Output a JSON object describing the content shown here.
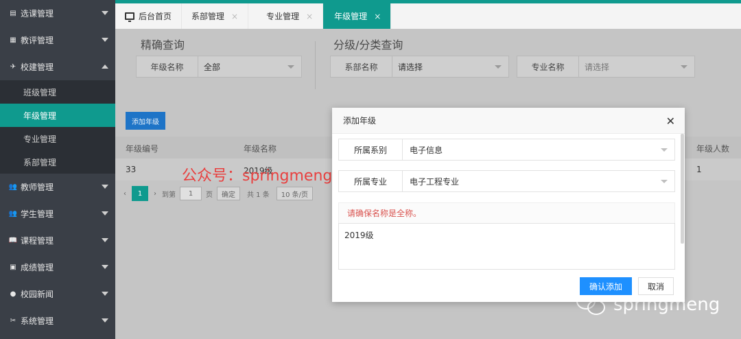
{
  "sidebar": {
    "items": [
      {
        "label": "选课管理",
        "icon": "document-icon"
      },
      {
        "label": "教评管理",
        "icon": "grid-icon"
      },
      {
        "label": "校建管理",
        "icon": "building-icon"
      },
      {
        "label": "教师管理",
        "icon": "users-icon"
      },
      {
        "label": "学生管理",
        "icon": "users-icon"
      },
      {
        "label": "课程管理",
        "icon": "book-icon"
      },
      {
        "label": "成绩管理",
        "icon": "clipboard-icon"
      },
      {
        "label": "校园新闻",
        "icon": "chat-icon"
      },
      {
        "label": "系统管理",
        "icon": "tools-icon"
      }
    ],
    "subitems": [
      "班级管理",
      "年级管理",
      "专业管理",
      "系部管理"
    ]
  },
  "tabs": [
    {
      "label": "后台首页"
    },
    {
      "label": "系部管理"
    },
    {
      "label": "专业管理"
    },
    {
      "label": "年级管理"
    }
  ],
  "tab_close": "×",
  "query": {
    "exact_title": "精确查询",
    "grade_label": "年级名称",
    "grade_value": "全部",
    "category_title": "分级/分类查询",
    "dept_label": "系部名称",
    "dept_value": "请选择",
    "major_label": "专业名称",
    "major_value": "请选择"
  },
  "add_button": "添加年级",
  "table": {
    "headers": [
      "年级编号",
      "年级名称",
      "年级人数"
    ],
    "rows": [
      [
        "33",
        "2019级",
        "1"
      ]
    ]
  },
  "pager": {
    "current": "1",
    "goto": "到第",
    "page_input": "1",
    "page_unit": "页",
    "confirm": "确定",
    "total": "共 1 条",
    "per_page": "10 条/页"
  },
  "watermark_left": "公众号：springmeng",
  "watermark_right": "springmeng",
  "modal": {
    "title": "添加年级",
    "close": "✕",
    "dept_label": "所属系别",
    "dept_value": "电子信息",
    "major_label": "所属专业",
    "major_value": "电子工程专业",
    "tip": "请确保名称是全称。",
    "name_value": "2019级",
    "confirm": "确认添加",
    "cancel": "取消"
  },
  "colors": {
    "accent": "#0f9a8e",
    "primary": "#1e90ff",
    "sidebar": "#3a3f47",
    "warning": "#d9534f"
  }
}
